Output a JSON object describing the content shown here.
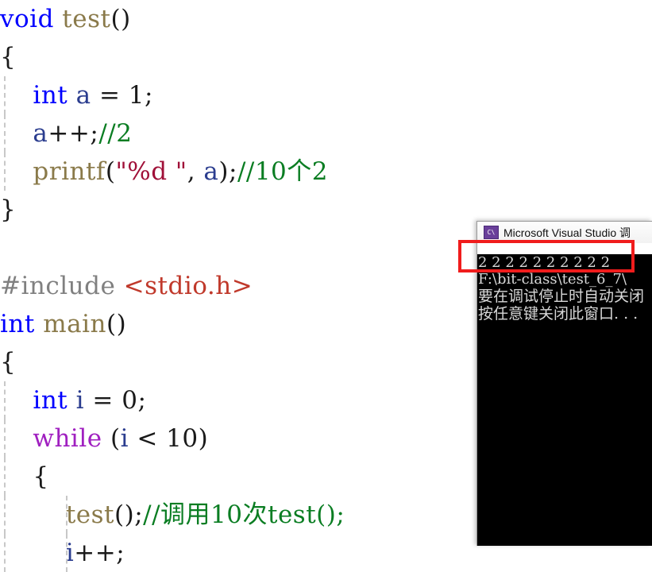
{
  "editor": {
    "lines": [
      {
        "indent_guides": 0,
        "tokens": [
          {
            "t": "void",
            "c": "kw"
          },
          {
            "t": " ",
            "c": "punc"
          },
          {
            "t": "test",
            "c": "fn"
          },
          {
            "t": "()",
            "c": "punc"
          }
        ]
      },
      {
        "indent_guides": 0,
        "tokens": [
          {
            "t": "{",
            "c": "punc"
          }
        ]
      },
      {
        "indent_guides": 1,
        "tokens": [
          {
            "t": "    ",
            "c": "punc"
          },
          {
            "t": "int",
            "c": "kw"
          },
          {
            "t": " ",
            "c": "punc"
          },
          {
            "t": "a",
            "c": "ident"
          },
          {
            "t": " = ",
            "c": "punc"
          },
          {
            "t": "1",
            "c": "num"
          },
          {
            "t": ";",
            "c": "punc"
          }
        ]
      },
      {
        "indent_guides": 1,
        "tokens": [
          {
            "t": "    ",
            "c": "punc"
          },
          {
            "t": "a",
            "c": "ident"
          },
          {
            "t": "++;",
            "c": "punc"
          },
          {
            "t": "//2",
            "c": "cmt"
          }
        ]
      },
      {
        "indent_guides": 1,
        "tokens": [
          {
            "t": "    ",
            "c": "punc"
          },
          {
            "t": "printf",
            "c": "fn"
          },
          {
            "t": "(",
            "c": "punc"
          },
          {
            "t": "\"%d \"",
            "c": "str"
          },
          {
            "t": ", ",
            "c": "punc"
          },
          {
            "t": "a",
            "c": "ident"
          },
          {
            "t": ");",
            "c": "punc"
          },
          {
            "t": "//10个2",
            "c": "cmt"
          }
        ]
      },
      {
        "indent_guides": 0,
        "tokens": [
          {
            "t": "}",
            "c": "punc"
          }
        ]
      },
      {
        "indent_guides": 0,
        "tokens": [
          {
            "t": "",
            "c": "punc"
          }
        ]
      },
      {
        "indent_guides": 0,
        "tokens": [
          {
            "t": "#include",
            "c": "pp"
          },
          {
            "t": " ",
            "c": "punc"
          },
          {
            "t": "<stdio.h>",
            "c": "inc"
          }
        ]
      },
      {
        "indent_guides": 0,
        "tokens": [
          {
            "t": "int",
            "c": "kw"
          },
          {
            "t": " ",
            "c": "punc"
          },
          {
            "t": "main",
            "c": "fn"
          },
          {
            "t": "()",
            "c": "punc"
          }
        ]
      },
      {
        "indent_guides": 0,
        "tokens": [
          {
            "t": "{",
            "c": "punc"
          }
        ]
      },
      {
        "indent_guides": 1,
        "tokens": [
          {
            "t": "    ",
            "c": "punc"
          },
          {
            "t": "int",
            "c": "kw"
          },
          {
            "t": " ",
            "c": "punc"
          },
          {
            "t": "i",
            "c": "ident"
          },
          {
            "t": " = ",
            "c": "punc"
          },
          {
            "t": "0",
            "c": "num"
          },
          {
            "t": ";",
            "c": "punc"
          }
        ]
      },
      {
        "indent_guides": 1,
        "tokens": [
          {
            "t": "    ",
            "c": "punc"
          },
          {
            "t": "while",
            "c": "kwctl"
          },
          {
            "t": " (",
            "c": "punc"
          },
          {
            "t": "i",
            "c": "ident"
          },
          {
            "t": " < ",
            "c": "punc"
          },
          {
            "t": "10",
            "c": "num"
          },
          {
            "t": ")",
            "c": "punc"
          }
        ]
      },
      {
        "indent_guides": 1,
        "tokens": [
          {
            "t": "    {",
            "c": "punc"
          }
        ]
      },
      {
        "indent_guides": 2,
        "tokens": [
          {
            "t": "        ",
            "c": "punc"
          },
          {
            "t": "test",
            "c": "fn"
          },
          {
            "t": "();",
            "c": "punc"
          },
          {
            "t": "//调用10次test();",
            "c": "cmt"
          }
        ]
      },
      {
        "indent_guides": 2,
        "tokens": [
          {
            "t": "        ",
            "c": "punc"
          },
          {
            "t": "i",
            "c": "ident"
          },
          {
            "t": "++;",
            "c": "punc"
          }
        ]
      }
    ]
  },
  "console": {
    "icon": "visual-studio-console-icon",
    "icon_glyph": "C\\",
    "title": "Microsoft Visual Studio 调",
    "output_lines": [
      {
        "text": "2 2 2 2 2 2 2 2 2 2",
        "cjk": false
      },
      {
        "text": "F:\\bit-class\\test_6_7\\",
        "cjk": false
      },
      {
        "text": "要在调试停止时自动关闭",
        "cjk": true
      },
      {
        "text": "按任意键关闭此窗口. . .",
        "cjk": true
      }
    ]
  },
  "annotation": {
    "type": "red-rectangle-highlight",
    "color": "#f01c1c",
    "targets_line": "2 2 2 2 2 2 2 2 2 2"
  }
}
